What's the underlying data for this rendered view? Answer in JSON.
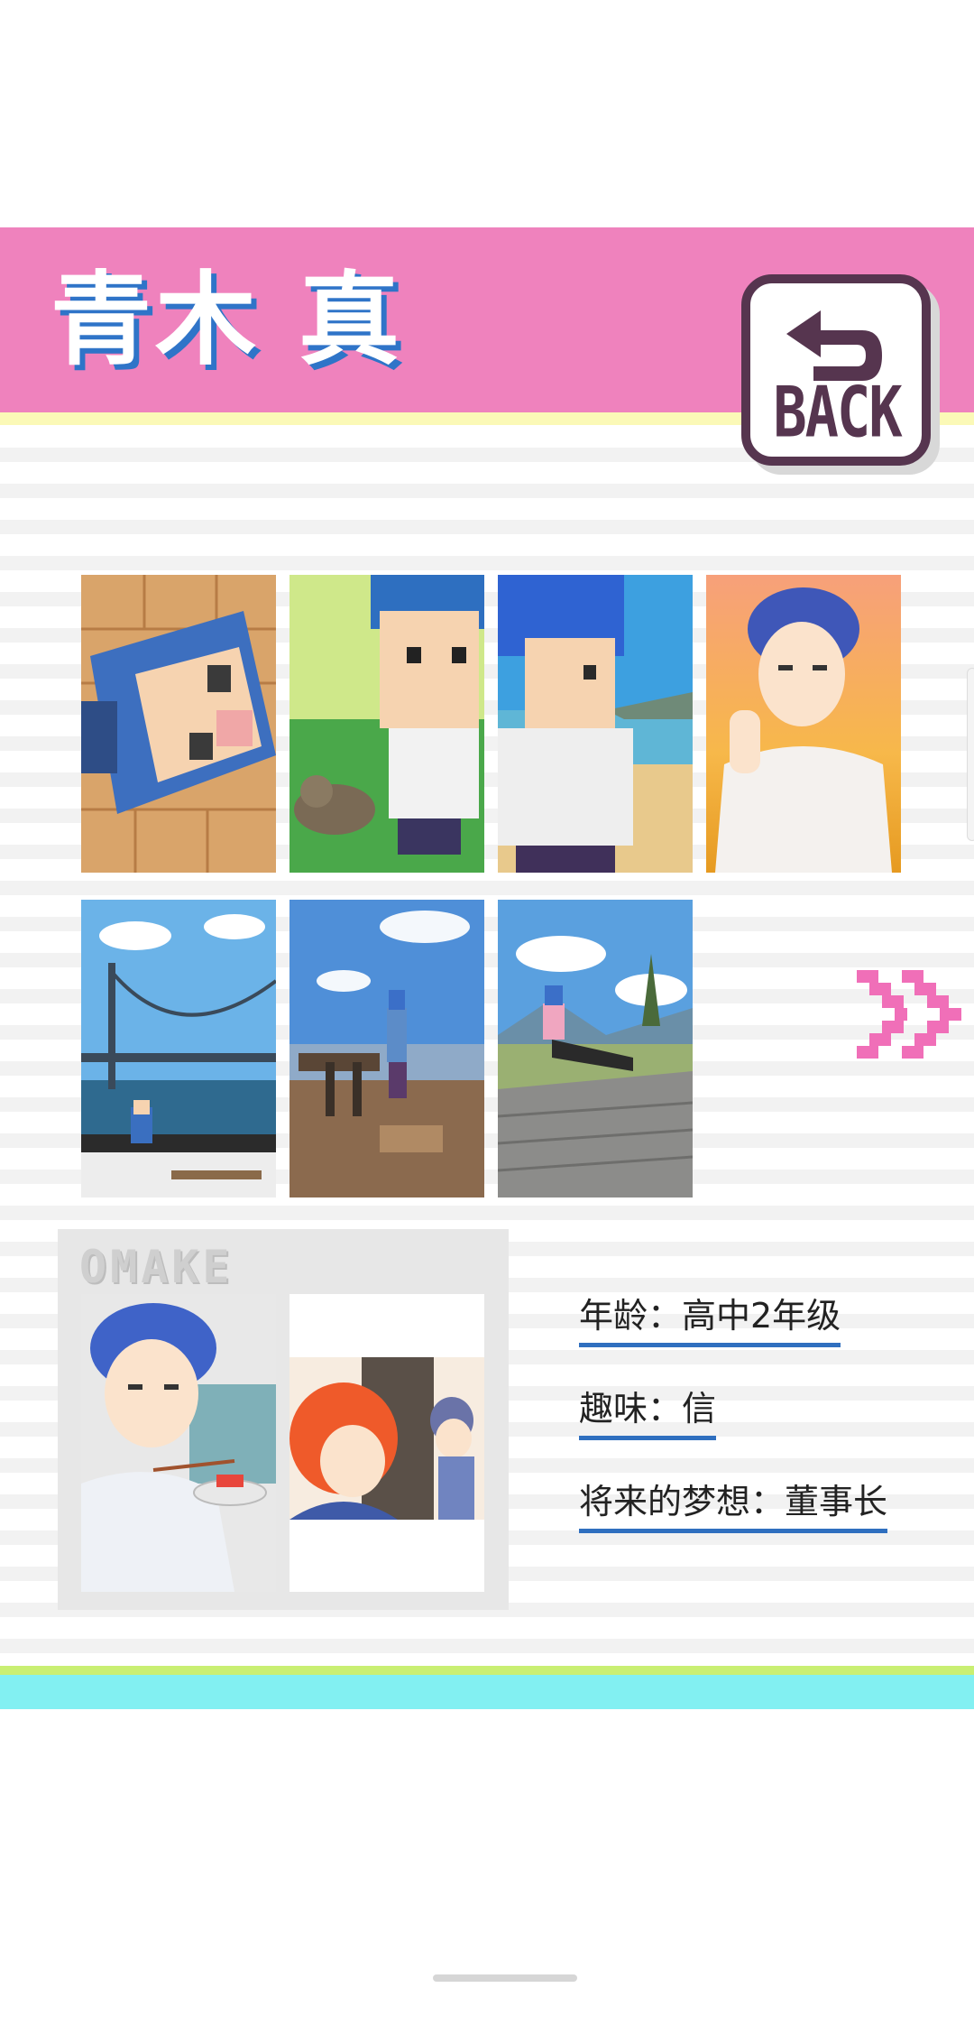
{
  "header": {
    "character_name": "青木 真",
    "back_label": "BACK"
  },
  "gallery": {
    "images": [
      {
        "name": "pixel-face-on-floor"
      },
      {
        "name": "pixel-boy-with-cat"
      },
      {
        "name": "pixel-boy-at-beach"
      },
      {
        "name": "anime-boy-sunset"
      },
      {
        "name": "bridge-photo-pixel-boy"
      },
      {
        "name": "observation-deck-pixel-boy"
      },
      {
        "name": "boardwalk-pixel-boy"
      }
    ]
  },
  "omake": {
    "label": "OMAKE",
    "images": [
      {
        "name": "boy-eating-sushi"
      },
      {
        "name": "redhead-and-boy"
      }
    ]
  },
  "profile": {
    "age": "年龄：高中2年级",
    "hobby": "趣味：信",
    "dream": "将来的梦想：董事长"
  },
  "colors": {
    "header_pink": "#ef82bd",
    "accent_yellow": "#fbf9b7",
    "title_shadow_blue": "#2f74c8",
    "back_button_plum": "#56354f",
    "arrow_pink": "#f06fb8",
    "underline_blue": "#2f6fbf",
    "footer_green": "#c9ef72",
    "footer_cyan": "#82f0f2"
  }
}
